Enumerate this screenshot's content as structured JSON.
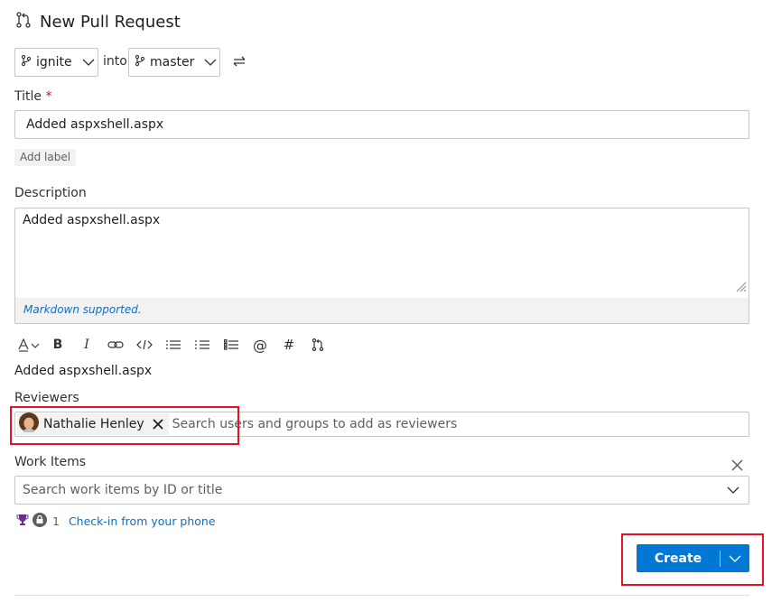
{
  "header": {
    "title": "New Pull Request",
    "icon": "pull-request-icon"
  },
  "branches": {
    "source": "ignite",
    "into_label": "into",
    "target": "master",
    "swap_icon": "swap-arrows-icon"
  },
  "title_field": {
    "label": "Title",
    "required_marker": "*",
    "value": "Added aspxshell.aspx"
  },
  "add_label": "Add label",
  "description": {
    "label": "Description",
    "value": "Added aspxshell.aspx",
    "markdown_note": "Markdown supported."
  },
  "toolbar": {
    "buttons": [
      "text-format-icon",
      "bold-icon",
      "italic-icon",
      "link-icon",
      "code-icon",
      "bulleted-list-icon",
      "numbered-list-icon",
      "checklist-icon",
      "mention-icon",
      "hashtag-icon",
      "pull-request-link-icon"
    ],
    "bold_glyph": "B",
    "italic_glyph": "I",
    "mention_glyph": "@",
    "hash_glyph": "#"
  },
  "preview_text": "Added aspxshell.aspx",
  "reviewers": {
    "label": "Reviewers",
    "chips": [
      {
        "name": "Nathalie Henley"
      }
    ],
    "placeholder": "Search users and groups to add as reviewers"
  },
  "work_items": {
    "label": "Work Items",
    "placeholder": "Search work items by ID or title"
  },
  "checkin": {
    "count": "1",
    "link": "Check-in from your phone"
  },
  "create_button": {
    "label": "Create"
  },
  "colors": {
    "primary": "#0078d4",
    "link": "#106ebe",
    "required": "#a4262c",
    "highlight": "#e81123"
  }
}
